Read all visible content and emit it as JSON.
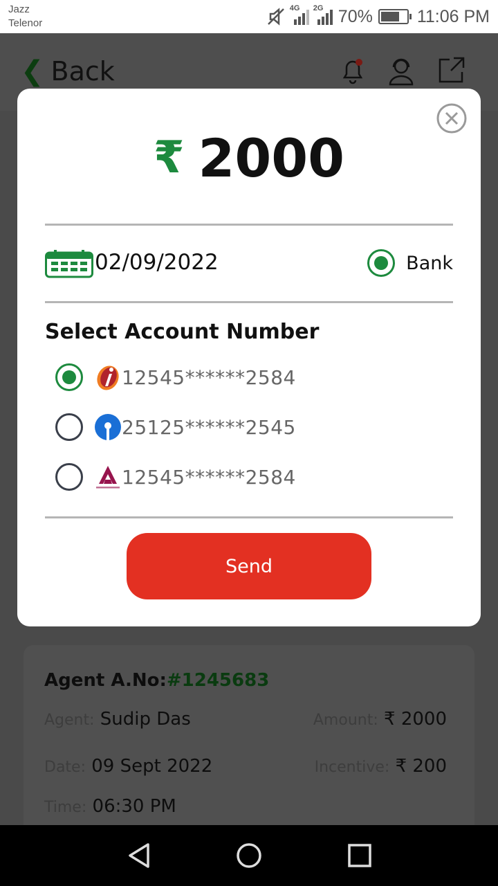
{
  "status_bar": {
    "carrier_1": "Jazz",
    "carrier_2": "Telenor",
    "net_1": "4G",
    "net_2": "2G",
    "battery": "70%",
    "time": "11:06 PM"
  },
  "header": {
    "back_label": "Back",
    "icons": [
      "bell-icon",
      "support-agent-icon",
      "share-icon"
    ]
  },
  "modal": {
    "currency_symbol": "₹",
    "amount": "2000",
    "date": "02/09/2022",
    "payment_mode": "Bank",
    "section_title": "Select Account Number",
    "accounts": [
      {
        "bank_icon": "icici-logo",
        "number": "12545******2584",
        "selected": true
      },
      {
        "bank_icon": "sbi-logo",
        "number": "25125******2545",
        "selected": false
      },
      {
        "bank_icon": "axis-bank-logo",
        "number": "12545******2584",
        "selected": false
      }
    ],
    "send_label": "Send"
  },
  "card": {
    "agent_no_label": "Agent A.No:",
    "agent_no_value": "#1245683",
    "agent_label": "Agent:",
    "agent_value": "Sudip Das",
    "amount_label": "Amount:",
    "amount_value": "₹ 2000",
    "date_label": "Date:",
    "date_value": "09 Sept 2022",
    "incentive_label": "Incentive:",
    "incentive_value": "₹ 200",
    "time_label": "Time:",
    "time_value": "06:30 PM"
  },
  "colors": {
    "accent_green": "#1d8a3e",
    "send_red": "#e33022"
  }
}
